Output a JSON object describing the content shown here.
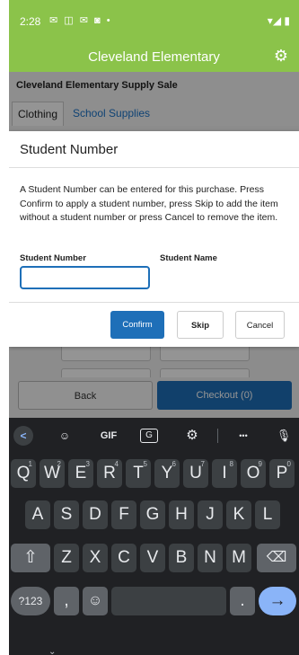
{
  "status_bar": {
    "time": "2:28",
    "notification_icons": "✉ ◫ ✉ ◙ •",
    "right_icons": "▾◢ ▮"
  },
  "app_bar": {
    "title": "Cleveland Elementary",
    "settings_icon": "gear-icon"
  },
  "page": {
    "header": "Cleveland Elementary Supply Sale",
    "tabs": [
      {
        "label": "Clothing",
        "active": true
      },
      {
        "label": "School Supplies",
        "active": false
      }
    ],
    "back_label": "Back",
    "checkout_label": "Checkout (0)"
  },
  "modal": {
    "title": "Student Number",
    "body": "A Student Number can be entered for this purchase. Press Confirm to apply a student number, press Skip to add the item without a student number or press Cancel to remove the item.",
    "student_number_label": "Student Number",
    "student_name_label": "Student Name",
    "student_number_value": "",
    "confirm_label": "Confirm",
    "skip_label": "Skip",
    "cancel_label": "Cancel"
  },
  "keyboard": {
    "toolbar": {
      "back": "<",
      "emoji": "☺",
      "gif": "GIF",
      "translate": "G",
      "settings": "⚙",
      "more": "•••",
      "mic": "🎙"
    },
    "row1": [
      {
        "k": "Q",
        "hint": "1"
      },
      {
        "k": "W",
        "hint": "2"
      },
      {
        "k": "E",
        "hint": "3"
      },
      {
        "k": "R",
        "hint": "4"
      },
      {
        "k": "T",
        "hint": "5"
      },
      {
        "k": "Y",
        "hint": "6"
      },
      {
        "k": "U",
        "hint": "7"
      },
      {
        "k": "I",
        "hint": "8"
      },
      {
        "k": "O",
        "hint": "9"
      },
      {
        "k": "P",
        "hint": "0"
      }
    ],
    "row2": [
      "A",
      "S",
      "D",
      "F",
      "G",
      "H",
      "J",
      "K",
      "L"
    ],
    "row3": [
      "Z",
      "X",
      "C",
      "V",
      "B",
      "N",
      "M"
    ],
    "shift": "⇧",
    "backspace": "⌫",
    "symbols": "?123",
    "comma": ",",
    "emoji_key": "☺",
    "period": ".",
    "enter": "→",
    "nav_chevron": "⌄"
  }
}
